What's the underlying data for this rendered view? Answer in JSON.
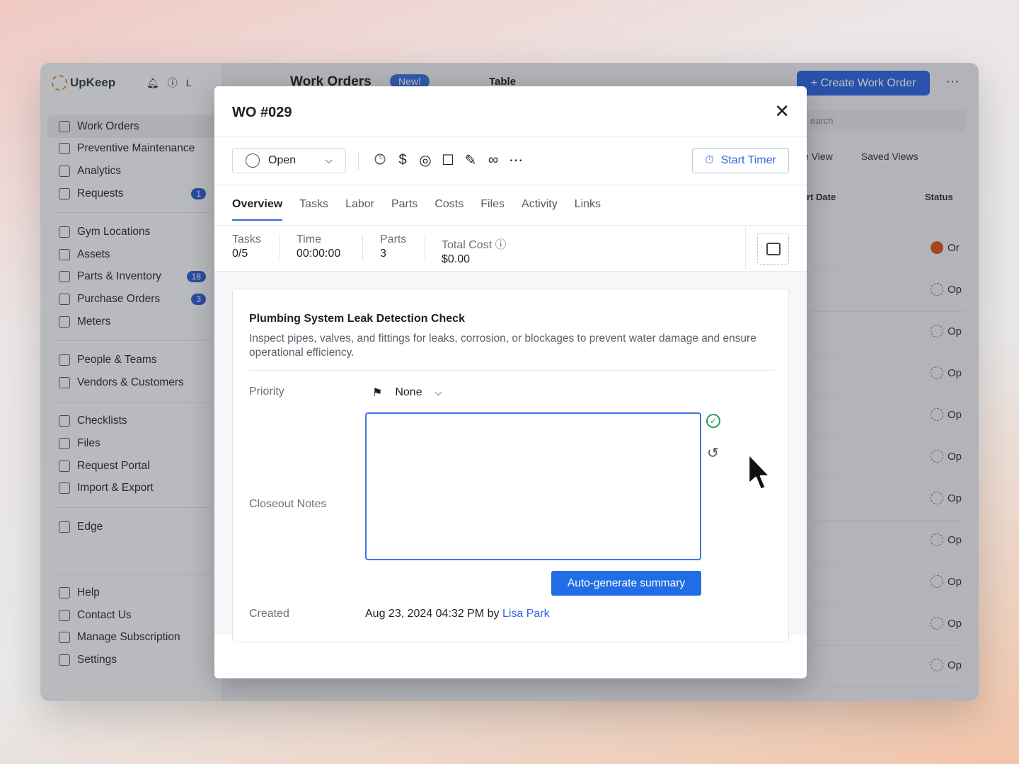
{
  "sidebar": {
    "brand": "UpKeep",
    "user_initial": "L",
    "groups": [
      [
        {
          "label": "Work Orders",
          "icon": "clipboard-icon",
          "active": true
        },
        {
          "label": "Preventive Maintenance",
          "icon": "calendar-icon"
        },
        {
          "label": "Analytics",
          "icon": "chart-icon"
        },
        {
          "label": "Requests",
          "icon": "inbox-icon",
          "badge": "1"
        }
      ],
      [
        {
          "label": "Gym Locations",
          "icon": "location-icon"
        },
        {
          "label": "Assets",
          "icon": "cube-icon"
        },
        {
          "label": "Parts & Inventory",
          "icon": "parts-icon",
          "badge": "18"
        },
        {
          "label": "Purchase Orders",
          "icon": "document-icon",
          "badge": "3"
        },
        {
          "label": "Meters",
          "icon": "meter-icon"
        }
      ],
      [
        {
          "label": "People & Teams",
          "icon": "people-icon"
        },
        {
          "label": "Vendors & Customers",
          "icon": "vendor-icon"
        }
      ],
      [
        {
          "label": "Checklists",
          "icon": "checklist-icon"
        },
        {
          "label": "Files",
          "icon": "files-icon"
        },
        {
          "label": "Request Portal",
          "icon": "portal-icon"
        },
        {
          "label": "Import & Export",
          "icon": "import-export-icon"
        }
      ],
      [
        {
          "label": "Edge",
          "icon": "edge-icon"
        }
      ],
      [
        {
          "label": "Help",
          "icon": "help-icon"
        },
        {
          "label": "Contact Us",
          "icon": "chat-icon"
        },
        {
          "label": "Manage Subscription",
          "icon": "card-icon"
        },
        {
          "label": "Settings",
          "icon": "gear-icon"
        }
      ]
    ]
  },
  "main": {
    "title": "Work Orders",
    "new_pill": "New!",
    "view_mode": "Table",
    "create_button": "+ Create Work Order",
    "search_placeholder": "earch",
    "view_label": "e View",
    "saved_views": "Saved Views",
    "col_date": "rt Date",
    "col_status": "Status",
    "row_status_text": "Op",
    "row_status_first": "Or"
  },
  "modal": {
    "title": "WO #029",
    "status": "Open",
    "start_timer": "Start Timer",
    "tabs": [
      "Overview",
      "Tasks",
      "Labor",
      "Parts",
      "Costs",
      "Files",
      "Activity",
      "Links"
    ],
    "stats": {
      "tasks_label": "Tasks",
      "tasks_value": "0/5",
      "time_label": "Time",
      "time_value": "00:00:00",
      "parts_label": "Parts",
      "parts_value": "3",
      "cost_label": "Total Cost",
      "cost_value": "$0.00"
    },
    "card": {
      "title": "Plumbing System Leak Detection Check",
      "description": "Inspect pipes, valves, and fittings for leaks, corrosion, or blockages to prevent water damage and ensure operational efficiency.",
      "priority_label": "Priority",
      "priority_value": "None",
      "closeout_label": "Closeout Notes",
      "closeout_value": "",
      "auto_button": "Auto-generate summary",
      "created_label": "Created",
      "created_value": "Aug 23, 2024 04:32 PM",
      "created_by": "by",
      "created_user": "Lisa Park"
    }
  },
  "colors": {
    "accent": "#2f66e0",
    "success": "#2e9d5a",
    "status_active": "#d9561a"
  }
}
